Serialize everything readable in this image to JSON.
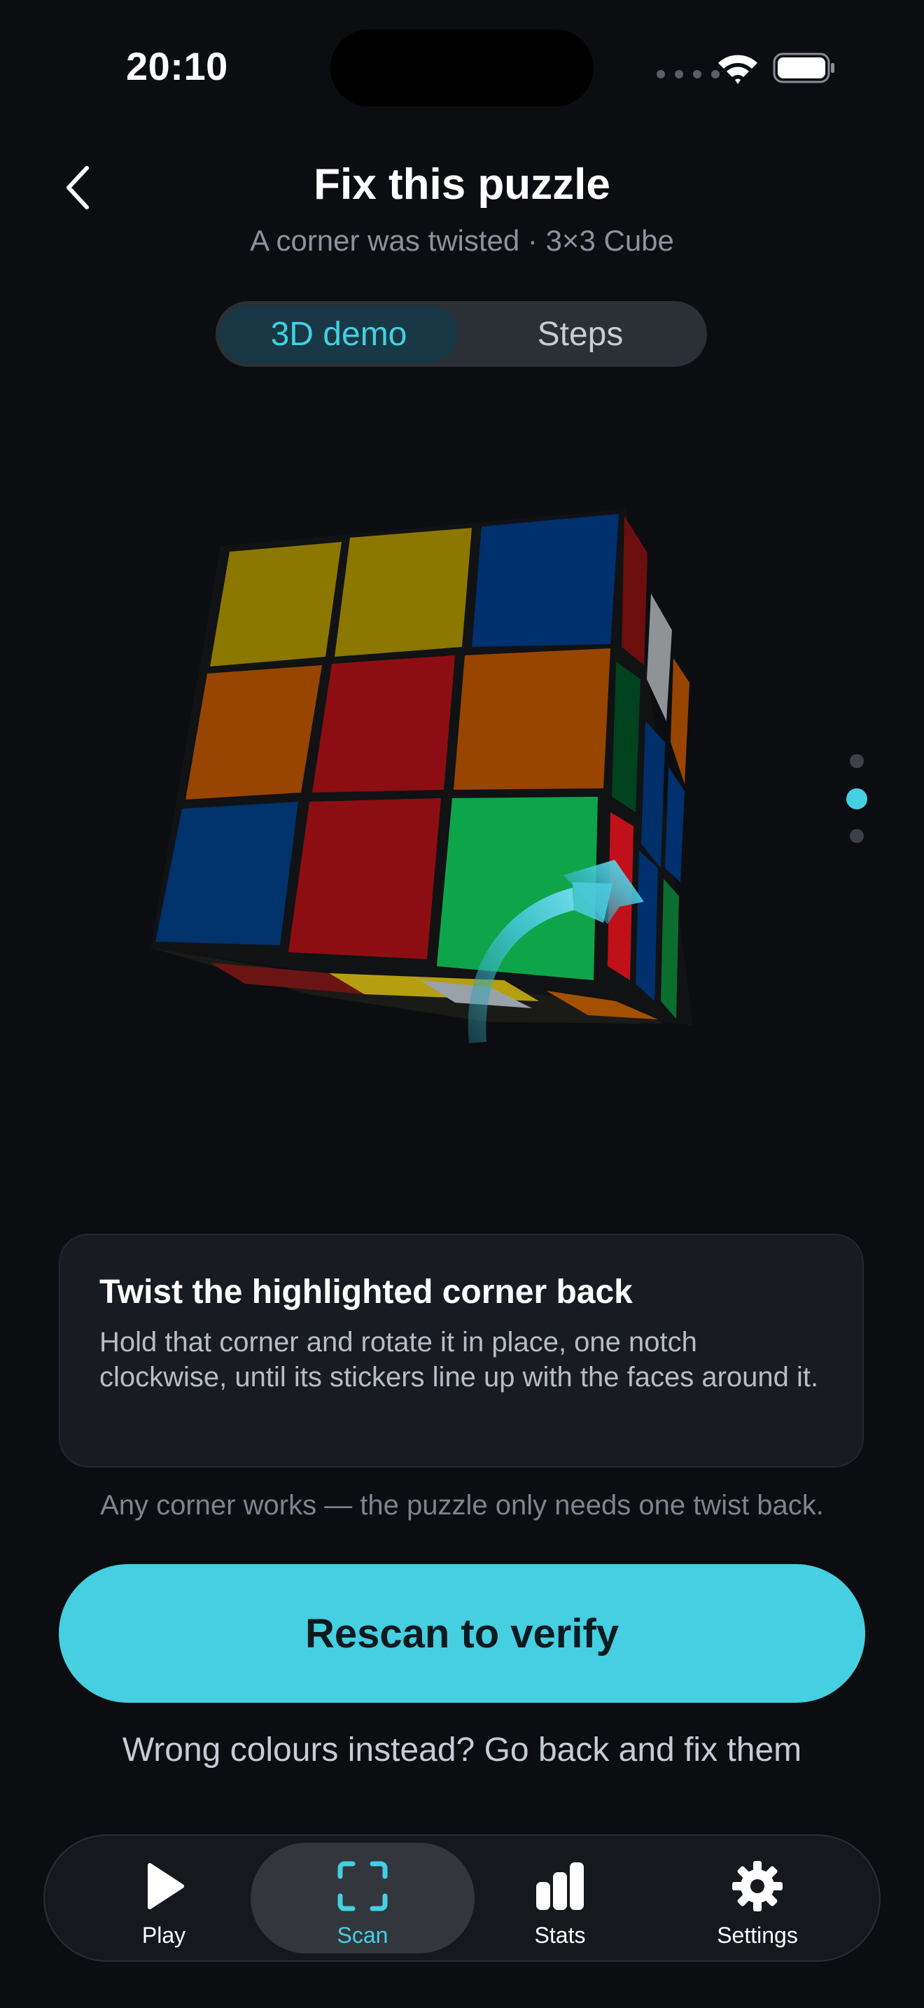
{
  "status_bar": {
    "time": "20:10"
  },
  "header": {
    "title": "Fix this puzzle",
    "subtitle": "A corner was twisted · 3×3 Cube"
  },
  "segmented": {
    "active": "3D demo",
    "inactive": "Steps"
  },
  "pager": {
    "pages": 3,
    "current": 2
  },
  "card": {
    "title": "Twist the highlighted corner back",
    "body": "Hold that corner and rotate it in place, one notch clockwise, until its stickers line up with the faces around it."
  },
  "hint": "Any corner works — the puzzle only needs one twist back.",
  "cta": {
    "label": "Rescan to verify"
  },
  "link": {
    "label": "Wrong colours instead? Go back and fix them"
  },
  "tabs": [
    {
      "label": "Play",
      "icon": "play-icon"
    },
    {
      "label": "Scan",
      "icon": "scan-icon",
      "active": true
    },
    {
      "label": "Stats",
      "icon": "stats-icon"
    },
    {
      "label": "Settings",
      "icon": "gear-icon"
    }
  ],
  "colors": {
    "accent": "#45cfe0",
    "background": "#0b0d11",
    "card": "#181b21"
  }
}
